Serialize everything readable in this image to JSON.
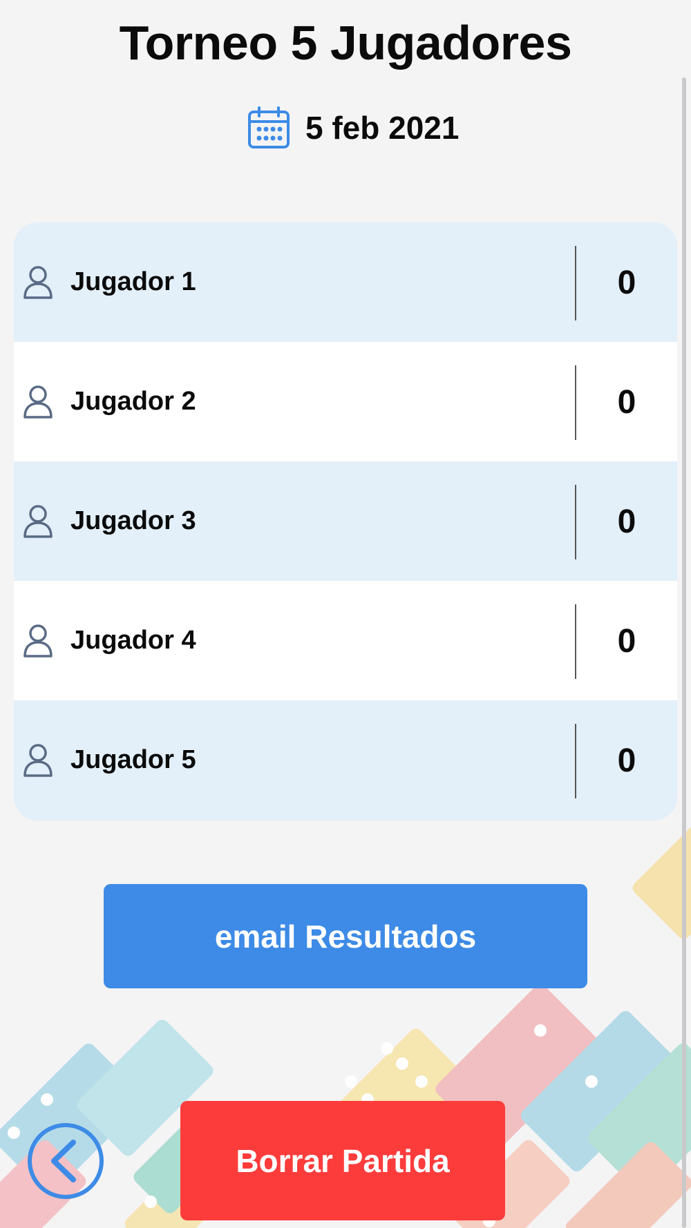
{
  "header": {
    "title": "Torneo 5 Jugadores",
    "date": "5 feb 2021"
  },
  "players": [
    {
      "name": "Jugador 1",
      "score": "0"
    },
    {
      "name": "Jugador 2",
      "score": "0"
    },
    {
      "name": "Jugador 3",
      "score": "0"
    },
    {
      "name": "Jugador 4",
      "score": "0"
    },
    {
      "name": "Jugador 5",
      "score": "0"
    }
  ],
  "actions": {
    "email_label": "email Resultados",
    "delete_label": "Borrar Partida"
  },
  "icons": {
    "calendar": "calendar-icon",
    "user": "user-icon",
    "back": "chevron-left-icon"
  },
  "colors": {
    "accent_blue": "#3d8be6",
    "danger_red": "#fc3c3b",
    "row_tint": "#e3eff9"
  }
}
